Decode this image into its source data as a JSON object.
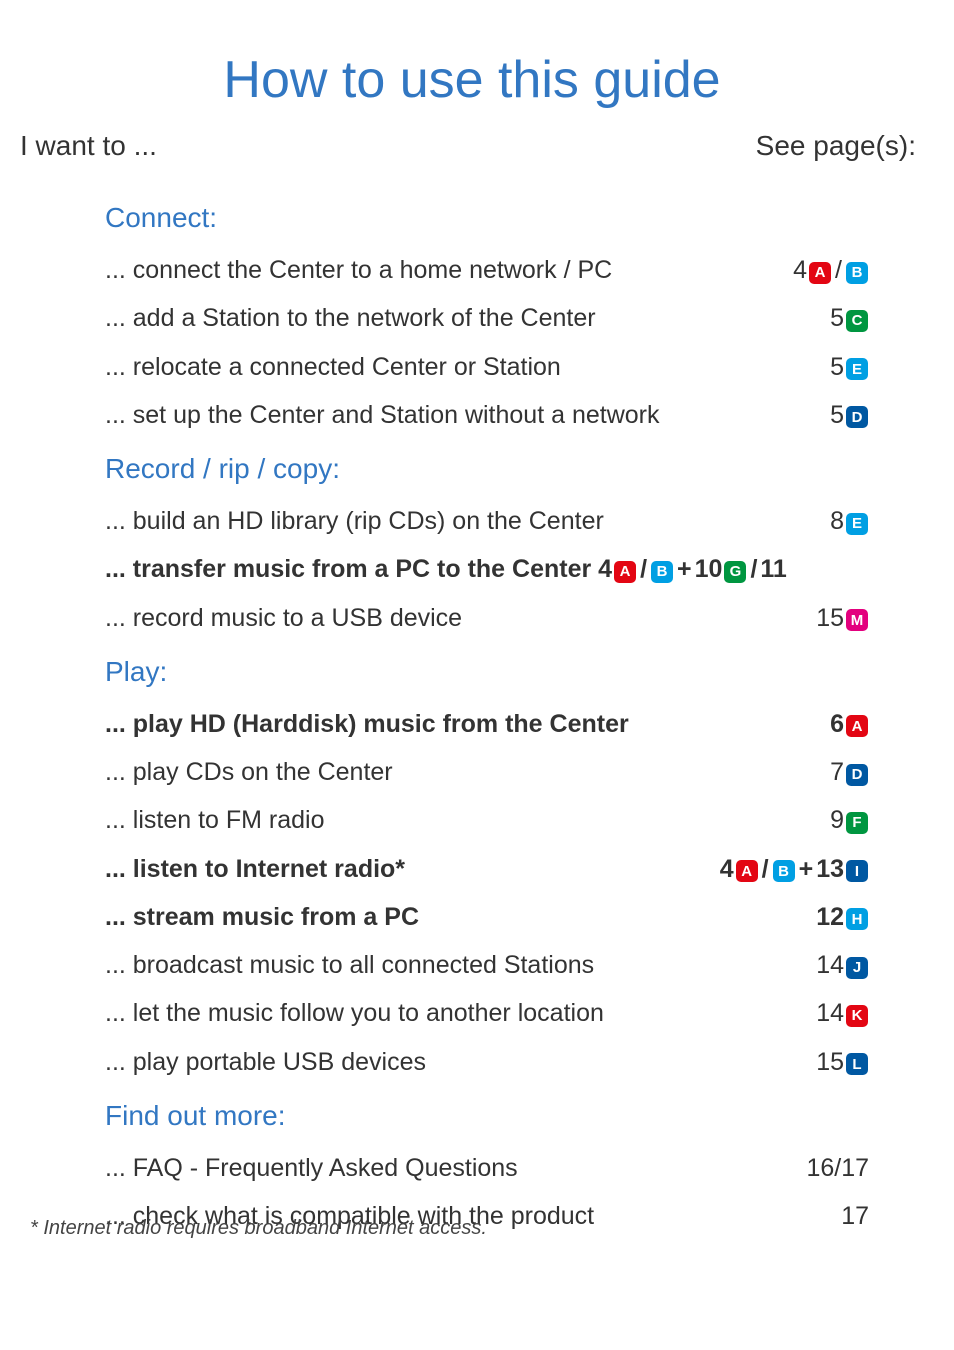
{
  "title": "How to use this guide",
  "header": {
    "left": "I want to ...",
    "right": "See page(s):"
  },
  "colors": {
    "A": "#e30613",
    "B": "#009fe3",
    "C": "#009640",
    "D": "#0058a2",
    "E": "#009fe3",
    "F": "#009640",
    "G": "#009640",
    "H": "#009fe3",
    "I": "#0058a2",
    "J": "#0058a2",
    "K": "#e30613",
    "L": "#0058a2",
    "M": "#e3007e"
  },
  "sections": [
    {
      "heading": "Connect:",
      "rows": [
        {
          "label": "... connect the Center to a home network / PC",
          "bold": false,
          "pages": [
            {
              "t": "num",
              "v": "4"
            },
            {
              "t": "badge",
              "v": "A"
            },
            {
              "t": "sep",
              "v": "/"
            },
            {
              "t": "badge",
              "v": "B"
            }
          ]
        },
        {
          "label": "... add a Station to the network of the Center",
          "bold": false,
          "pages": [
            {
              "t": "num",
              "v": "5"
            },
            {
              "t": "badge",
              "v": "C"
            }
          ]
        },
        {
          "label": "... relocate a connected Center or Station",
          "bold": false,
          "pages": [
            {
              "t": "num",
              "v": "5"
            },
            {
              "t": "badge",
              "v": "E"
            }
          ]
        },
        {
          "label": "... set up the Center and Station without a network",
          "bold": false,
          "pages": [
            {
              "t": "num",
              "v": "5"
            },
            {
              "t": "badge",
              "v": "D"
            }
          ]
        }
      ]
    },
    {
      "heading": "Record / rip / copy:",
      "rows": [
        {
          "label": "... build an HD library (rip CDs) on the Center",
          "bold": false,
          "pages": [
            {
              "t": "num",
              "v": "8"
            },
            {
              "t": "badge",
              "v": "E"
            }
          ]
        },
        {
          "label": "... transfer music from a PC to the Center",
          "bold": true,
          "inline_pages": true,
          "pages": [
            {
              "t": "num",
              "v": "4"
            },
            {
              "t": "badge",
              "v": "A"
            },
            {
              "t": "sep",
              "v": "/"
            },
            {
              "t": "badge",
              "v": "B"
            },
            {
              "t": "sep",
              "v": " + "
            },
            {
              "t": "num",
              "v": "10"
            },
            {
              "t": "badge",
              "v": "G"
            },
            {
              "t": "sep",
              "v": "/"
            },
            {
              "t": "num",
              "v": "11"
            }
          ]
        },
        {
          "label": "... record music to a USB device",
          "bold": false,
          "pages": [
            {
              "t": "num",
              "v": "15"
            },
            {
              "t": "badge",
              "v": "M"
            }
          ]
        }
      ]
    },
    {
      "heading": "Play:",
      "rows": [
        {
          "label": "... play HD (Harddisk) music from the Center",
          "bold": true,
          "pages": [
            {
              "t": "num",
              "v": "6"
            },
            {
              "t": "badge",
              "v": "A"
            }
          ]
        },
        {
          "label": "... play CDs on the Center",
          "bold": false,
          "pages": [
            {
              "t": "num",
              "v": "7"
            },
            {
              "t": "badge",
              "v": "D"
            }
          ]
        },
        {
          "label": "... listen to FM radio",
          "bold": false,
          "pages": [
            {
              "t": "num",
              "v": "9"
            },
            {
              "t": "badge",
              "v": "F"
            }
          ]
        },
        {
          "label": "... listen to Internet radio*",
          "bold": true,
          "pages": [
            {
              "t": "num",
              "v": "4"
            },
            {
              "t": "badge",
              "v": "A"
            },
            {
              "t": "sep",
              "v": "/"
            },
            {
              "t": "badge",
              "v": "B"
            },
            {
              "t": "sep",
              "v": " + "
            },
            {
              "t": "num",
              "v": "13"
            },
            {
              "t": "badge",
              "v": "I"
            }
          ]
        },
        {
          "label": "... stream music from a PC",
          "bold": true,
          "pages": [
            {
              "t": "num",
              "v": "12"
            },
            {
              "t": "badge",
              "v": "H"
            }
          ]
        },
        {
          "label": "... broadcast music to all connected Stations",
          "bold": false,
          "pages": [
            {
              "t": "num",
              "v": "14"
            },
            {
              "t": "badge",
              "v": "J"
            }
          ]
        },
        {
          "label": "... let the music follow you to another location",
          "bold": false,
          "pages": [
            {
              "t": "num",
              "v": "14"
            },
            {
              "t": "badge",
              "v": "K"
            }
          ]
        },
        {
          "label": "... play portable USB devices",
          "bold": false,
          "pages": [
            {
              "t": "num",
              "v": "15"
            },
            {
              "t": "badge",
              "v": "L"
            }
          ]
        }
      ]
    },
    {
      "heading": "Find out more:",
      "rows": [
        {
          "label": "... FAQ - Frequently Asked Questions",
          "bold": false,
          "pages": [
            {
              "t": "num",
              "v": "16/17"
            }
          ]
        },
        {
          "label": "... check what is compatible with the product",
          "bold": false,
          "pages": [
            {
              "t": "num",
              "v": "17"
            }
          ]
        }
      ]
    }
  ],
  "footnote": "*  Internet radio requires broadband Internet access."
}
